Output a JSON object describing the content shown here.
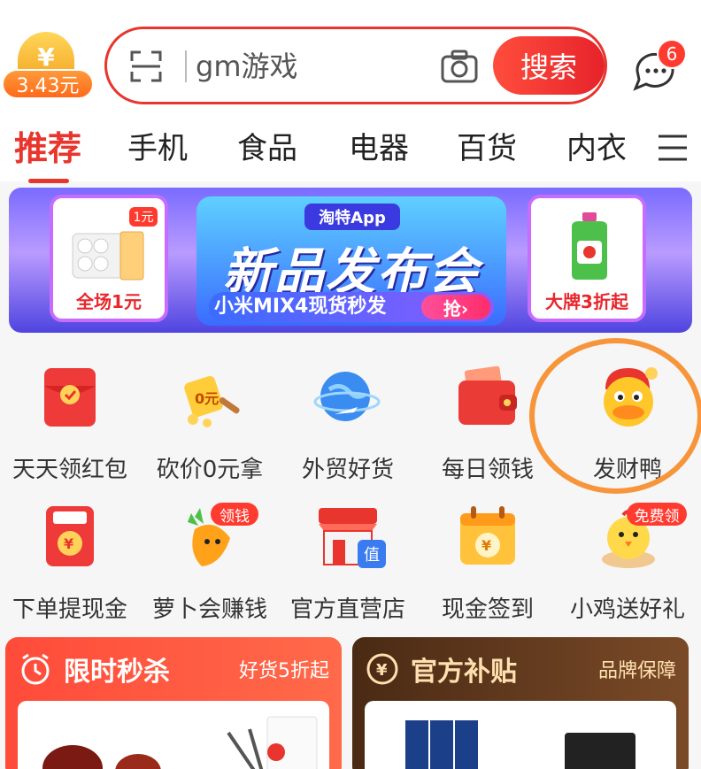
{
  "header": {
    "coin_symbol": "¥",
    "coin_amount": "3.43元",
    "search": {
      "placeholder": "gm游戏",
      "button_label": "搜索"
    },
    "message_badge": "6"
  },
  "tabs": [
    {
      "label": "推荐"
    },
    {
      "label": "手机"
    },
    {
      "label": "食品"
    },
    {
      "label": "电器"
    },
    {
      "label": "百货"
    },
    {
      "label": "内衣"
    }
  ],
  "banner": {
    "left_tag": "1元",
    "left_caption": "全场1元",
    "app_label": "淘特App",
    "title": "新品发布会",
    "subtitle": "小米MIX4现货秒发",
    "grab_label": "抢›",
    "right_caption": "大牌3折起"
  },
  "grid": [
    {
      "label": "天天领红包",
      "icon": "red-envelope-icon"
    },
    {
      "label": "砍价0元拿",
      "icon": "bargain-axe-icon"
    },
    {
      "label": "外贸好货",
      "icon": "globe-plane-icon"
    },
    {
      "label": "每日领钱",
      "icon": "wallet-icon"
    },
    {
      "label": "发财鸭",
      "icon": "lucky-duck-icon"
    },
    {
      "label": "下单提现金",
      "icon": "cash-envelope-icon"
    },
    {
      "label": "萝卜会赚钱",
      "icon": "carrot-icon",
      "tag": "领钱"
    },
    {
      "label": "官方直营店",
      "icon": "store-icon",
      "tag_inner": "值"
    },
    {
      "label": "现金签到",
      "icon": "calendar-yen-icon"
    },
    {
      "label": "小鸡送好礼",
      "icon": "chick-icon",
      "tag": "免费领"
    }
  ],
  "cards": {
    "flash": {
      "title": "限时秒杀",
      "subtitle": "好货5折起"
    },
    "subsidy": {
      "title": "官方补贴",
      "subtitle": "品牌保障"
    }
  },
  "colors": {
    "accent": "#e8352d",
    "highlight_ring": "#f7953b"
  }
}
